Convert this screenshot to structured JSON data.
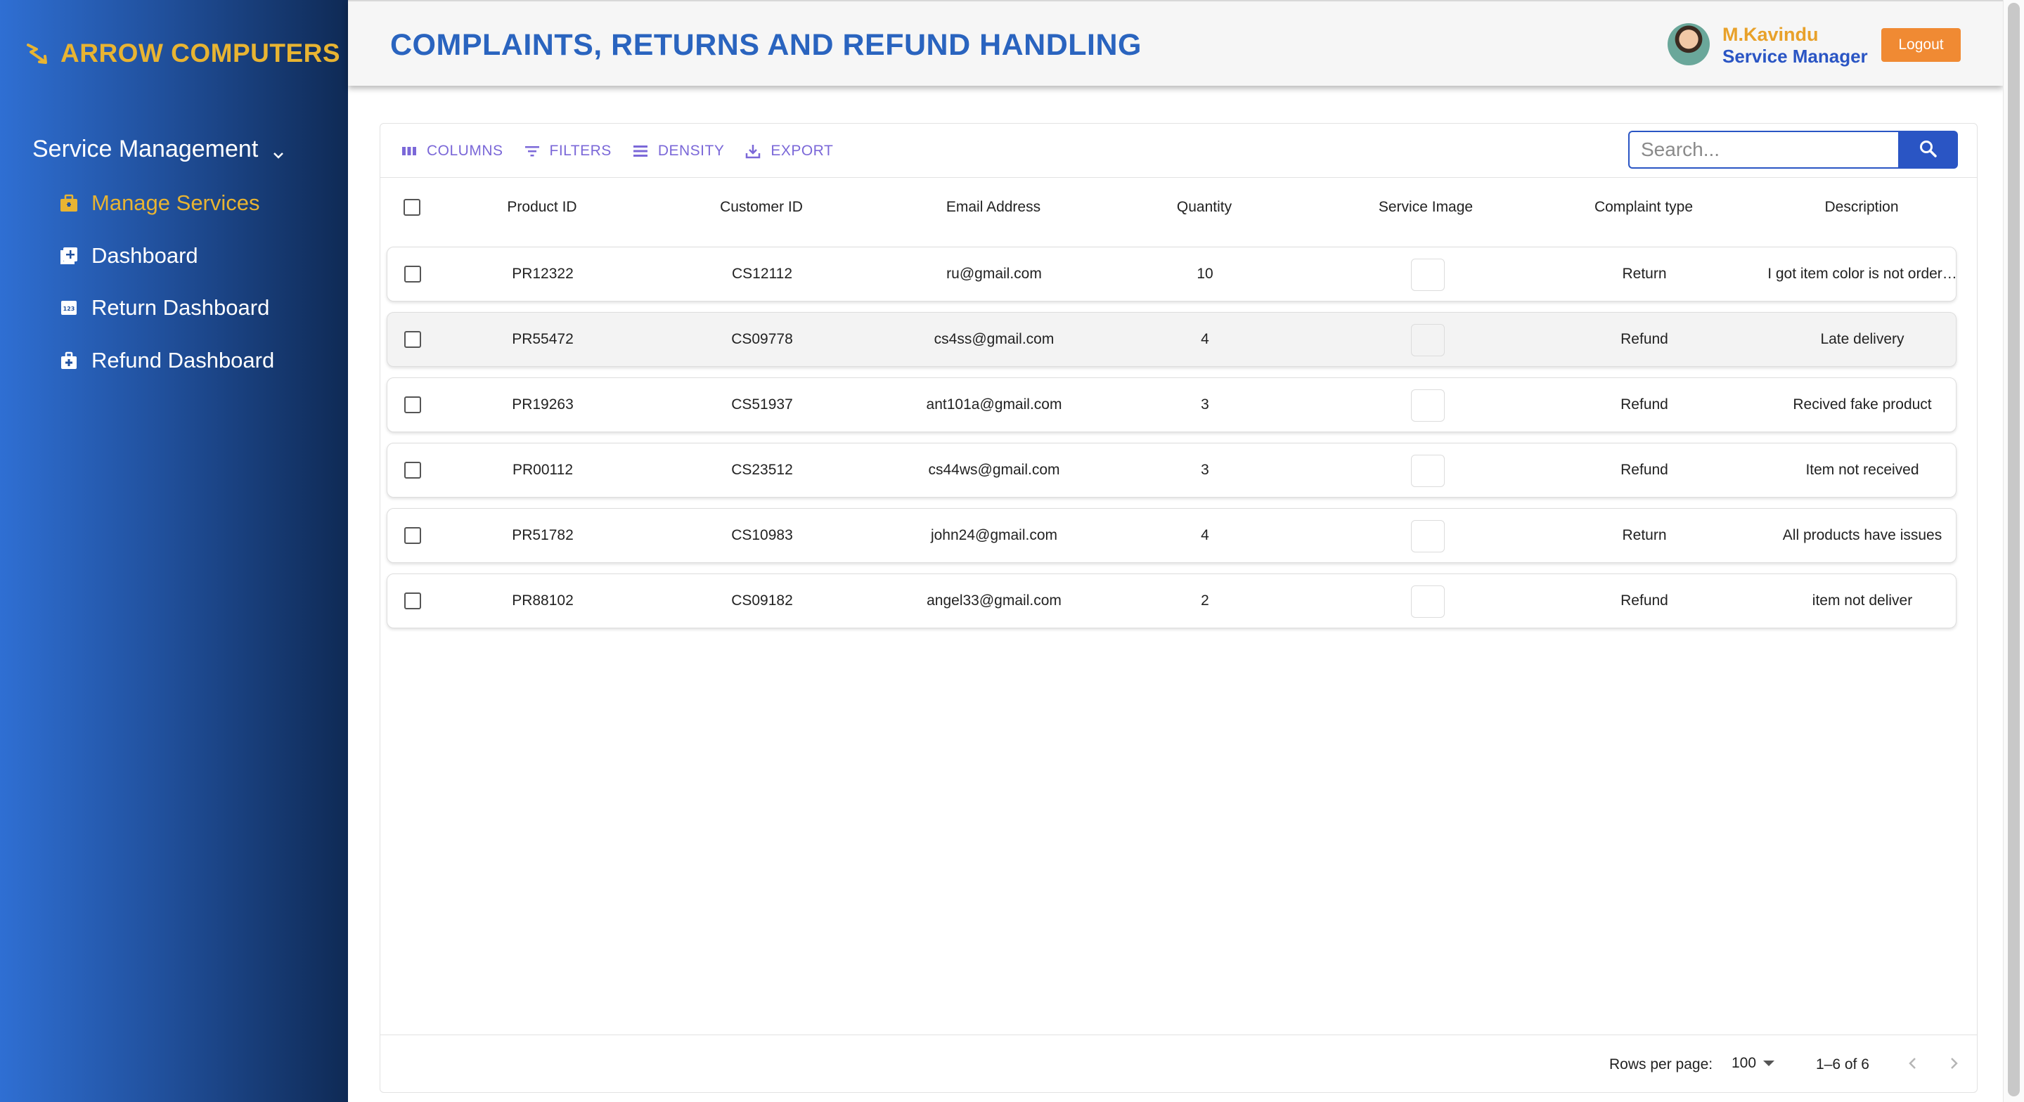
{
  "brand": {
    "name": "ARROW COMPUTERS",
    "icon": "arrow-logo-icon"
  },
  "sidebar": {
    "group_label": "Service Management",
    "items": [
      {
        "label": "Manage Services",
        "icon": "briefcase-icon",
        "active": true
      },
      {
        "label": "Dashboard",
        "icon": "add-box-icon",
        "active": false
      },
      {
        "label": "Return Dashboard",
        "icon": "numbers-box-icon",
        "active": false
      },
      {
        "label": "Refund Dashboard",
        "icon": "medical-bag-icon",
        "active": false
      }
    ]
  },
  "header": {
    "title": "COMPLAINTS, RETURNS AND REFUND HANDLING",
    "user_name": "M.Kavindu",
    "user_role": "Service Manager",
    "logout_label": "Logout"
  },
  "toolbar": {
    "columns": "COLUMNS",
    "filters": "FILTERS",
    "density": "DENSITY",
    "export": "EXPORT",
    "search_placeholder": "Search..."
  },
  "table": {
    "columns": [
      "Product ID",
      "Customer ID",
      "Email Address",
      "Quantity",
      "Service Image",
      "Complaint type",
      "Description"
    ],
    "rows": [
      {
        "product_id": "PR12322",
        "customer_id": "CS12112",
        "email": "ru@gmail.com",
        "quantity": "10",
        "complaint_type": "Return",
        "description": "I got item color is not order…"
      },
      {
        "product_id": "PR55472",
        "customer_id": "CS09778",
        "email": "cs4ss@gmail.com",
        "quantity": "4",
        "complaint_type": "Refund",
        "description": "Late delivery"
      },
      {
        "product_id": "PR19263",
        "customer_id": "CS51937",
        "email": "ant101a@gmail.com",
        "quantity": "3",
        "complaint_type": "Refund",
        "description": "Recived fake product"
      },
      {
        "product_id": "PR00112",
        "customer_id": "CS23512",
        "email": "cs44ws@gmail.com",
        "quantity": "3",
        "complaint_type": "Refund",
        "description": "Item not received"
      },
      {
        "product_id": "PR51782",
        "customer_id": "CS10983",
        "email": "john24@gmail.com",
        "quantity": "4",
        "complaint_type": "Return",
        "description": "All products have issues"
      },
      {
        "product_id": "PR88102",
        "customer_id": "CS09182",
        "email": "angel33@gmail.com",
        "quantity": "2",
        "complaint_type": "Refund",
        "description": "item not deliver"
      }
    ]
  },
  "pagination": {
    "rows_per_page_label": "Rows per page:",
    "rows_per_page_value": "100",
    "range": "1–6 of 6"
  },
  "colors": {
    "accent": "#2a55c4",
    "brand_gold": "#e8b432",
    "logout": "#f08a33",
    "toolbar": "#7b68d8"
  }
}
